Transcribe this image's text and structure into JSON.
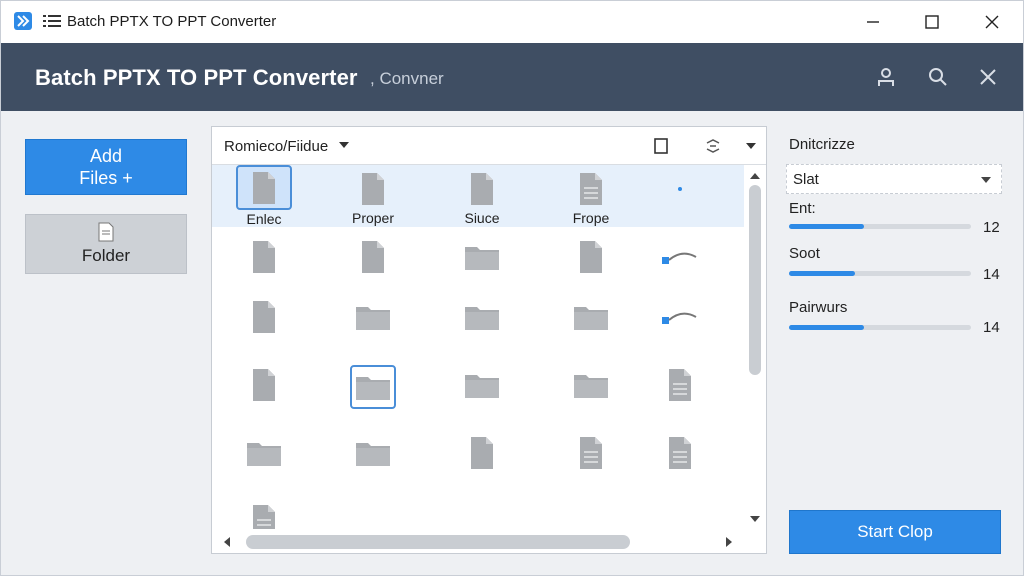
{
  "window": {
    "title": "Batch PPTX TO PPT Converter"
  },
  "header": {
    "title": "Batch PPTX TO PPT Converter",
    "subtitle": ", Convner"
  },
  "left": {
    "add_line1": "Add",
    "add_line2": "Files +",
    "folder_label": "Folder"
  },
  "browser": {
    "path": "Romieco/Fiidue",
    "files": [
      {
        "icon": "file-icon",
        "label": "Enlec",
        "selected": true
      },
      {
        "icon": "file-icon",
        "label": "Proper"
      },
      {
        "icon": "file-icon",
        "label": "Siuce"
      },
      {
        "icon": "document-icon",
        "label": "Frope"
      },
      {
        "icon": "dot-icon",
        "label": ""
      },
      {
        "icon": "file-icon",
        "label": ""
      },
      {
        "icon": "file-icon",
        "label": ""
      },
      {
        "icon": "folder-icon",
        "label": ""
      },
      {
        "icon": "file-icon",
        "label": ""
      },
      {
        "icon": "link-icon",
        "label": ""
      },
      {
        "icon": "file-icon",
        "label": ""
      },
      {
        "icon": "folder-icon",
        "label": ""
      },
      {
        "icon": "folder-icon",
        "label": ""
      },
      {
        "icon": "folder-icon",
        "label": ""
      },
      {
        "icon": "link-icon",
        "label": ""
      },
      {
        "icon": "file-icon",
        "label": ""
      },
      {
        "icon": "folder-icon",
        "label": "",
        "outlined": true
      },
      {
        "icon": "folder-icon",
        "label": ""
      },
      {
        "icon": "folder-icon",
        "label": ""
      },
      {
        "icon": "document-icon",
        "label": ""
      },
      {
        "icon": "folder-icon",
        "label": ""
      },
      {
        "icon": "folder-icon",
        "label": ""
      },
      {
        "icon": "file-icon",
        "label": ""
      },
      {
        "icon": "document-icon",
        "label": ""
      },
      {
        "icon": "document-icon",
        "label": ""
      },
      {
        "icon": "document-icon",
        "label": ""
      }
    ]
  },
  "right": {
    "title": "Dnitcrizze",
    "select_value": "Slat",
    "sliders": [
      {
        "label": "Ent:",
        "value": "12",
        "fraction": 0.41
      },
      {
        "label": "Soot",
        "value": "14",
        "fraction": 0.36
      },
      {
        "label": "Pairwurs",
        "value": "14",
        "fraction": 0.41
      }
    ],
    "start_label": "Start Clop"
  },
  "colors": {
    "accent": "#2e8ae6",
    "header": "#3f4e63",
    "selection": "#e6f0fb"
  }
}
